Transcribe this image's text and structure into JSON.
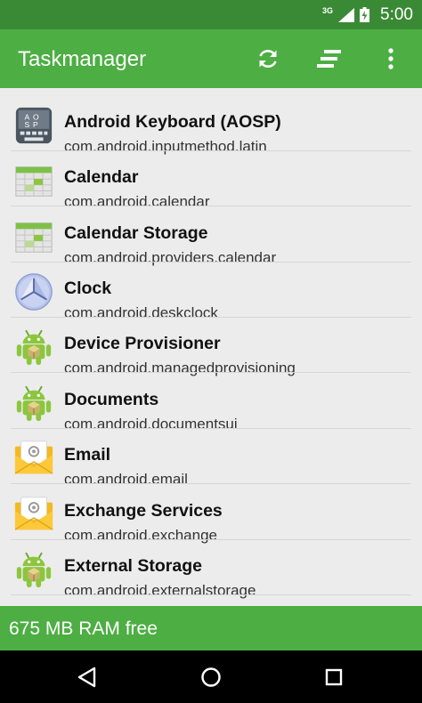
{
  "status_bar": {
    "network_label": "3G",
    "time": "5:00",
    "icons": [
      "signal-icon",
      "battery-icon"
    ]
  },
  "app_bar": {
    "title": "Taskmanager",
    "actions": [
      "refresh-icon",
      "sort-icon",
      "more-vert-icon"
    ]
  },
  "apps": [
    {
      "name": "Android Keyboard (AOSP)",
      "package": "com.android.inputmethod.latin",
      "icon": "keyboard-app-icon"
    },
    {
      "name": "Calendar",
      "package": "com.android.calendar",
      "icon": "calendar-app-icon"
    },
    {
      "name": "Calendar Storage",
      "package": "com.android.providers.calendar",
      "icon": "calendar-app-icon"
    },
    {
      "name": "Clock",
      "package": "com.android.deskclock",
      "icon": "clock-app-icon"
    },
    {
      "name": "Device Provisioner",
      "package": "com.android.managedprovisioning",
      "icon": "android-robot-icon"
    },
    {
      "name": "Documents",
      "package": "com.android.documentsui",
      "icon": "android-robot-icon"
    },
    {
      "name": "Email",
      "package": "com.android.email",
      "icon": "email-app-icon"
    },
    {
      "name": "Exchange Services",
      "package": "com.android.exchange",
      "icon": "email-app-icon"
    },
    {
      "name": "External Storage",
      "package": "com.android.externalstorage",
      "icon": "android-robot-icon"
    }
  ],
  "footer": {
    "ram_text": "675 MB RAM free"
  },
  "nav_bar": {
    "buttons": [
      "back-icon",
      "home-icon",
      "recents-icon"
    ]
  },
  "colors": {
    "status_bar": "#3a8a35",
    "app_bar": "#4cae43",
    "footer": "#4cae43",
    "list_background": "#ececec",
    "nav_bar": "#000000"
  }
}
